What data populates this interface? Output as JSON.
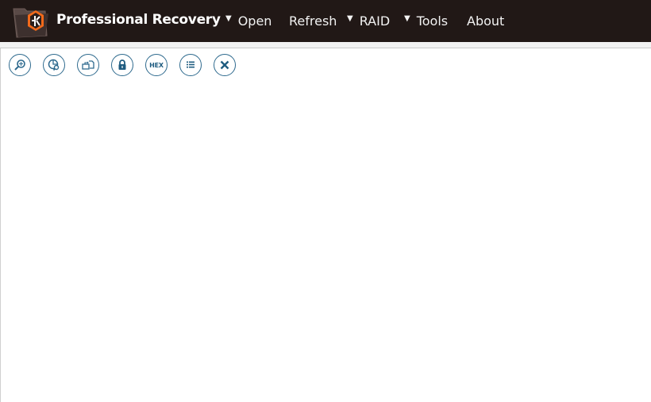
{
  "header": {
    "app_title": "Professional Recovery",
    "logo_icon": "folder-recovery-logo",
    "menu": [
      {
        "label": "Open",
        "has_dropdown": true
      },
      {
        "label": "Refresh",
        "has_dropdown": false
      },
      {
        "label": "RAID",
        "has_dropdown": true
      },
      {
        "label": "Tools",
        "has_dropdown": true
      },
      {
        "label": "About",
        "has_dropdown": false
      }
    ],
    "dropdown_glyph": "▼"
  },
  "toolbar": {
    "buttons": [
      {
        "icon": "search-icon"
      },
      {
        "icon": "partition-search-icon"
      },
      {
        "icon": "copy-files-icon"
      },
      {
        "icon": "lock-icon"
      },
      {
        "icon": "hex-icon",
        "label": "HEX"
      },
      {
        "icon": "list-icon"
      },
      {
        "icon": "close-icon"
      }
    ]
  },
  "colors": {
    "header_bg": "#211816",
    "accent": "#2e6a8e",
    "logo_orange": "#f26a1b"
  }
}
